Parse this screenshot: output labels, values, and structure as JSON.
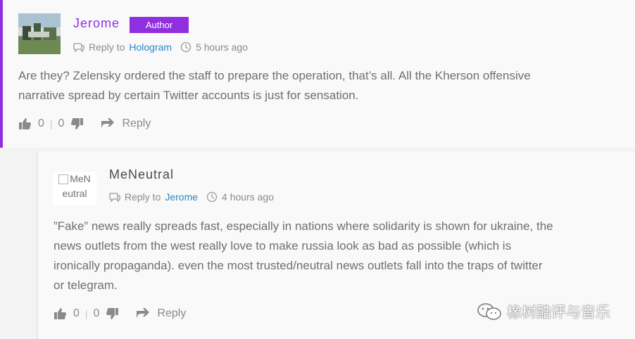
{
  "comment1": {
    "author": "Jerome",
    "badge": "Author",
    "reply_to_label": "Reply to",
    "reply_to_user": "Hologram",
    "time": "5 hours ago",
    "text_line1": "Are they? Zelensky ordered the staff to prepare the operation, that’s all. All the Kherson offensive",
    "text_line2": "narrative spread by certain Twitter accounts is just for sensation.",
    "upvotes": "0",
    "downvotes": "0",
    "reply_label": "Reply"
  },
  "comment2": {
    "author": "MeNeutral",
    "avatar_alt_line1": "MeN",
    "avatar_alt_line2": "eutral",
    "reply_to_label": "Reply to",
    "reply_to_user": "Jerome",
    "time": "4 hours ago",
    "text_line1": "”Fake” news really spreads fast, especially in nations where solidarity is shown for ukraine, the",
    "text_line2": "news outlets from the west really love to make russia look as bad as possible (which is",
    "text_line3": "ironically propaganda). even the most trusted/neutral news outlets fall into the traps of twitter",
    "text_line4": "or telegram.",
    "upvotes": "0",
    "downvotes": "0",
    "reply_label": "Reply"
  },
  "watermark": {
    "text": "橡树酷评与音乐",
    "icon": "wechat-icon"
  },
  "colors": {
    "accent": "#8f2fe0",
    "link": "#2b87c7"
  }
}
